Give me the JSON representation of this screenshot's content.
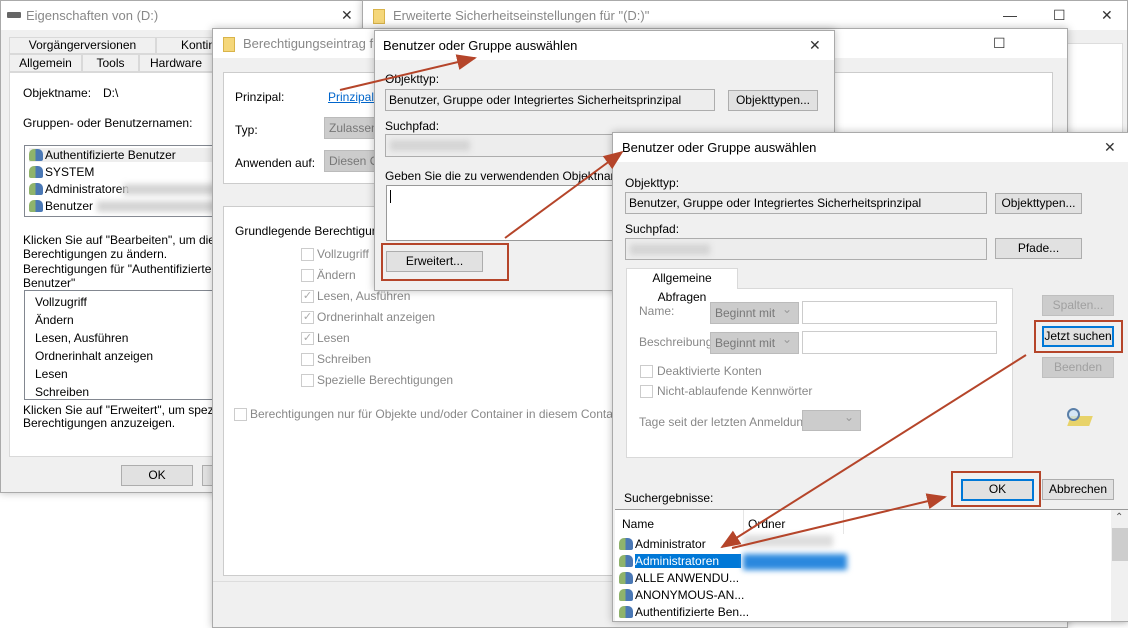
{
  "props": {
    "title": "Eigenschaften von  (D:)",
    "tabs_row1": [
      "Vorgängerversionen",
      "Konting"
    ],
    "tabs_row2": [
      "Allgemein",
      "Tools",
      "Hardware"
    ],
    "object_label": "Objektname:",
    "object_value": "D:\\",
    "groups_label": "Gruppen- oder Benutzernamen:",
    "users": [
      "Authentifizierte Benutzer",
      "SYSTEM",
      "Administratoren",
      "Benutzer"
    ],
    "hint1": "Klicken Sie auf \"Bearbeiten\", um die",
    "hint1b": "Berechtigungen zu ändern.",
    "perm_for": "Berechtigungen für \"Authentifizierte",
    "perm_for_b": "Benutzer\"",
    "perms": [
      "Vollzugriff",
      "Ändern",
      "Lesen, Ausführen",
      "Ordnerinhalt anzeigen",
      "Lesen",
      "Schreiben"
    ],
    "hint2": "Klicken Sie auf \"Erweitert\", um spezielle",
    "hint2b": "Berechtigungen anzuzeigen.",
    "ok": "OK"
  },
  "adv": {
    "title": "Erweiterte Sicherheitseinstellungen für \"(D:)\""
  },
  "entry": {
    "title": "Berechtigungseintrag für",
    "principal_label": "Prinzipal:",
    "principal_link": "Prinzipal",
    "type_label": "Typ:",
    "type_value": "Zulassen",
    "apply_label": "Anwenden auf:",
    "apply_value": "Diesen O",
    "basic_label": "Grundlegende Berechtigungen",
    "perms": [
      {
        "label": "Vollzugriff",
        "checked": false
      },
      {
        "label": "Ändern",
        "checked": false
      },
      {
        "label": "Lesen, Ausführen",
        "checked": true
      },
      {
        "label": "Ordnerinhalt anzeigen",
        "checked": true
      },
      {
        "label": "Lesen",
        "checked": true
      },
      {
        "label": "Schreiben",
        "checked": false
      },
      {
        "label": "Spezielle Berechtigungen",
        "checked": false
      }
    ],
    "only_container": "Berechtigungen nur für Objekte und/oder Container in diesem Conta"
  },
  "select1": {
    "title": "Benutzer oder Gruppe auswählen",
    "objtype_label": "Objekttyp:",
    "objtype_value": "Benutzer, Gruppe oder Integriertes Sicherheitsprinzipal",
    "objtypes_btn": "Objekttypen...",
    "path_label": "Suchpfad:",
    "names_label": "Geben Sie die zu verwendenden Objektnamen e",
    "advanced_btn": "Erweitert..."
  },
  "select2": {
    "title": "Benutzer oder Gruppe auswählen",
    "objtype_label": "Objekttyp:",
    "objtype_value": "Benutzer, Gruppe oder Integriertes Sicherheitsprinzipal",
    "objtypes_btn": "Objekttypen...",
    "path_label": "Suchpfad:",
    "paths_btn": "Pfade...",
    "tab": "Allgemeine Abfragen",
    "name_label": "Name:",
    "desc_label": "Beschreibung:",
    "starts_with": "Beginnt mit",
    "disabled_accounts": "Deaktivierte Konten",
    "nonexpiring": "Nicht-ablaufende Kennwörter",
    "days_label": "Tage seit der letzten Anmeldung:",
    "columns_btn": "Spalten...",
    "search_btn": "Jetzt suchen",
    "stop_btn": "Beenden",
    "results_label": "Suchergebnisse:",
    "ok_btn": "OK",
    "cancel_btn": "Abbrechen",
    "col_name": "Name",
    "col_folder": "Ordner",
    "results": [
      "Administrator",
      "Administratoren",
      "ALLE ANWENDU...",
      "ANONYMOUS-AN...",
      "Authentifizierte Ben..."
    ]
  },
  "colors": {
    "accent": "#0078d7",
    "annotation": "#b5452a",
    "link": "#0066cc"
  }
}
